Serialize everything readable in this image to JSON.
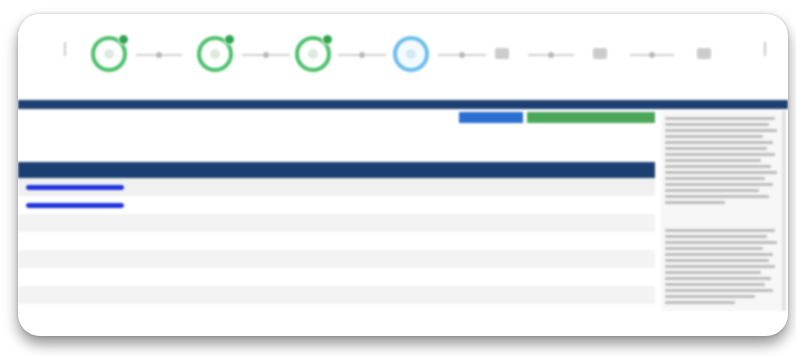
{
  "wizard": {
    "steps": [
      {
        "label": "",
        "state": "completed"
      },
      {
        "label": "",
        "state": "completed"
      },
      {
        "label": "",
        "state": "completed"
      },
      {
        "label": "",
        "state": "current"
      },
      {
        "label": "",
        "state": "pending"
      },
      {
        "label": "",
        "state": "pending"
      },
      {
        "label": "",
        "state": "pending"
      }
    ],
    "colors": {
      "completed": "#4cc06a",
      "current": "#6cbcec",
      "pending": "#cccccc"
    }
  },
  "section": {
    "title": ""
  },
  "actions": {
    "primary_label": "",
    "secondary_label": ""
  },
  "summary": {
    "description": "",
    "timestamp": ""
  },
  "table": {
    "columns": [
      "",
      ""
    ],
    "rows": [
      {
        "name": "",
        "value": ""
      },
      {
        "name": "",
        "value": ""
      }
    ]
  },
  "sidebar": {
    "paragraphs": [
      "",
      ""
    ]
  },
  "colors": {
    "header_bar": "#1c3f72",
    "primary_button": "#2a6ed1",
    "secondary_button": "#4aa75a",
    "link": "#1d32e0"
  }
}
